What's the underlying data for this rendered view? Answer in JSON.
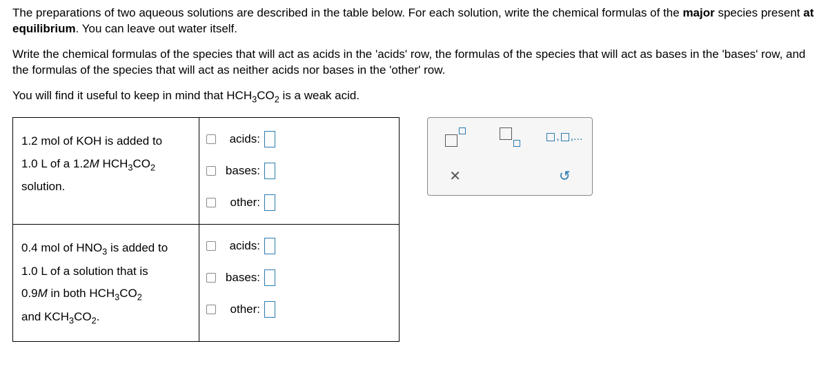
{
  "intro": {
    "p1a": "The preparations of two aqueous solutions are described in the table below. For each solution, write the chemical formulas of the ",
    "p1b": "major",
    "p1c": " species present ",
    "p1d": "at equilibrium",
    "p1e": ". You can leave out water itself.",
    "p2": "Write the chemical formulas of the species that will act as acids in the 'acids' row, the formulas of the species that will act as bases in the 'bases' row, and the formulas of the species that will act as neither acids nor bases in the 'other' row.",
    "p3a": "You will find it useful to keep in mind that ",
    "p3b": " is a weak acid."
  },
  "formula_hch3co2": {
    "a": "HCH",
    "b": "3",
    "c": "CO",
    "d": "2"
  },
  "rows": [
    {
      "desc": {
        "l1a": "1.2",
        "l1b": " mol of ",
        "l1c": "KOH",
        "l1d": " is added to",
        "l2a": "1.0 L",
        "l2b": " of a ",
        "l2c": "1.2",
        "l2d": "M",
        "l3": "solution."
      }
    },
    {
      "desc": {
        "l1a": "0.4",
        "l1b": " mol of ",
        "l1c": "HNO",
        "l1c_sub": "3",
        "l1d": " is added to",
        "l2a": "1.0 L",
        "l2b": " of a solution that is",
        "l3a": "0.9",
        "l3b": "M",
        "l3c": " in both ",
        "l4a": "and ",
        "l4b": "KCH",
        "l4c": "3",
        "l4d": "CO",
        "l4e": "2",
        "l4f": "."
      }
    }
  ],
  "labels": {
    "acids": "acids:",
    "bases": "bases:",
    "other": "other:"
  },
  "palette": {
    "list_suffix": ",..."
  }
}
